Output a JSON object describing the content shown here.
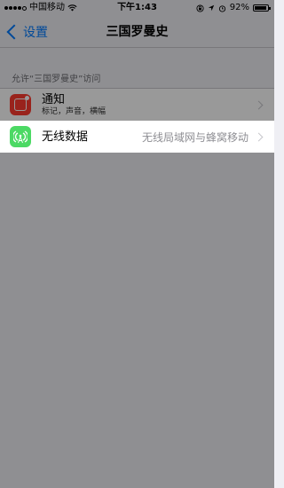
{
  "status_bar": {
    "carrier": "中国移动",
    "time": "下午1:43",
    "battery_percent": "92%",
    "battery_level": 0.92,
    "icons": [
      "signal-dots-icon",
      "wifi-icon",
      "lock-rotation-icon",
      "location-icon",
      "alarm-icon",
      "battery-icon"
    ]
  },
  "nav": {
    "back_label": "设置",
    "title": "三国罗曼史"
  },
  "section": {
    "header": "允许“三国罗曼史”访问"
  },
  "rows": [
    {
      "title": "通知",
      "subtitle": "标记，声音，横幅",
      "icon": "notification-icon",
      "icon_color": "#ff3b30"
    },
    {
      "title": "无线数据",
      "detail": "无线局域网与蜂窝移动",
      "icon": "cellular-antenna-icon",
      "icon_color": "#4cd964"
    }
  ],
  "colors": {
    "accent": "#007aff",
    "background": "#efeff4"
  }
}
